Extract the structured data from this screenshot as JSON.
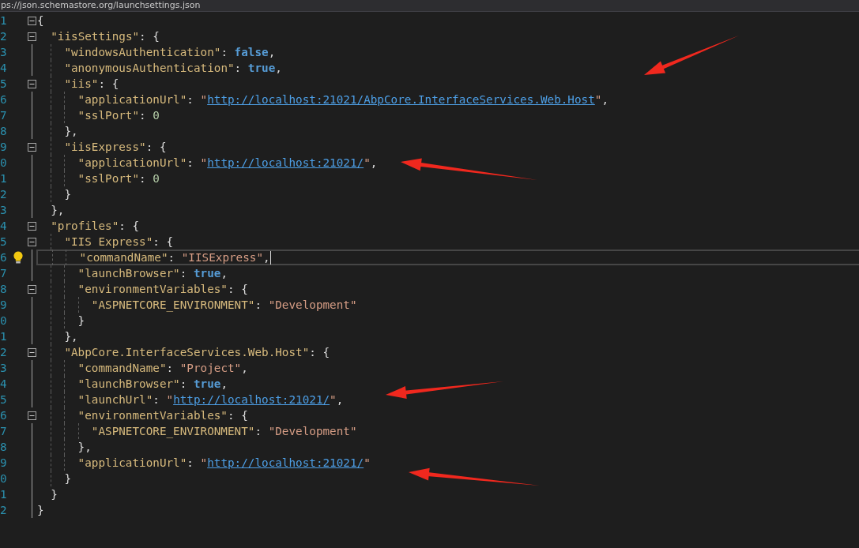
{
  "address_bar": {
    "text": "ps://json.schemastore.org/launchsettings.json"
  },
  "lines": [
    {
      "number": "1",
      "tokens": [
        {
          "kind": "punct",
          "text": "{"
        }
      ],
      "children": [
        {
          "number": "2",
          "tokens": [
            {
              "kind": "key",
              "text": "\"iisSettings\""
            },
            {
              "kind": "punct",
              "text": ": {"
            }
          ],
          "children": [
            {
              "number": "3",
              "tokens": [
                {
                  "kind": "key",
                  "text": "\"windowsAuthentication\""
                },
                {
                  "kind": "punct",
                  "text": ": "
                },
                {
                  "kind": "keyword",
                  "text": "false"
                },
                {
                  "kind": "punct",
                  "text": ","
                }
              ]
            },
            {
              "number": "4",
              "tokens": [
                {
                  "kind": "key",
                  "text": "\"anonymousAuthentication\""
                },
                {
                  "kind": "punct",
                  "text": ": "
                },
                {
                  "kind": "keyword",
                  "text": "true"
                },
                {
                  "kind": "punct",
                  "text": ","
                }
              ]
            },
            {
              "number": "5",
              "tokens": [
                {
                  "kind": "key",
                  "text": "\"iis\""
                },
                {
                  "kind": "punct",
                  "text": ": {"
                }
              ],
              "children": [
                {
                  "number": "6",
                  "tokens": [
                    {
                      "kind": "key",
                      "text": "\"applicationUrl\""
                    },
                    {
                      "kind": "punct",
                      "text": ": "
                    },
                    {
                      "kind": "string",
                      "text": "\""
                    },
                    {
                      "kind": "url",
                      "text": "http://localhost:21021/AbpCore.InterfaceServices.Web.Host"
                    },
                    {
                      "kind": "string",
                      "text": "\""
                    },
                    {
                      "kind": "punct",
                      "text": ","
                    }
                  ]
                },
                {
                  "number": "7",
                  "tokens": [
                    {
                      "kind": "key",
                      "text": "\"sslPort\""
                    },
                    {
                      "kind": "punct",
                      "text": ": "
                    },
                    {
                      "kind": "number",
                      "text": "0"
                    }
                  ]
                }
              ]
            },
            {
              "number": "8",
              "tokens": [
                {
                  "kind": "punct",
                  "text": "},"
                }
              ]
            },
            {
              "number": "9",
              "tokens": [
                {
                  "kind": "key",
                  "text": "\"iisExpress\""
                },
                {
                  "kind": "punct",
                  "text": ": {"
                }
              ],
              "children": [
                {
                  "number": "0",
                  "tokens": [
                    {
                      "kind": "key",
                      "text": "\"applicationUrl\""
                    },
                    {
                      "kind": "punct",
                      "text": ": "
                    },
                    {
                      "kind": "string",
                      "text": "\""
                    },
                    {
                      "kind": "url",
                      "text": "http://localhost:21021/"
                    },
                    {
                      "kind": "string",
                      "text": "\""
                    },
                    {
                      "kind": "punct",
                      "text": ","
                    }
                  ]
                },
                {
                  "number": "1",
                  "tokens": [
                    {
                      "kind": "key",
                      "text": "\"sslPort\""
                    },
                    {
                      "kind": "punct",
                      "text": ": "
                    },
                    {
                      "kind": "number",
                      "text": "0"
                    }
                  ]
                }
              ]
            },
            {
              "number": "2",
              "tokens": [
                {
                  "kind": "punct",
                  "text": "}"
                }
              ]
            }
          ]
        },
        {
          "number": "3",
          "tokens": [
            {
              "kind": "punct",
              "text": "},"
            }
          ]
        },
        {
          "number": "4",
          "tokens": [
            {
              "kind": "key",
              "text": "\"profiles\""
            },
            {
              "kind": "punct",
              "text": ": {"
            }
          ],
          "children": [
            {
              "number": "5",
              "tokens": [
                {
                  "kind": "key",
                  "text": "\"IIS Express\""
                },
                {
                  "kind": "punct",
                  "text": ": {"
                }
              ],
              "children": [
                {
                  "number": "6",
                  "current": true,
                  "lightbulb": true,
                  "tokens": [
                    {
                      "kind": "key",
                      "text": "\"commandName\""
                    },
                    {
                      "kind": "punct",
                      "text": ": "
                    },
                    {
                      "kind": "string",
                      "text": "\"IISExpress\""
                    },
                    {
                      "kind": "punct",
                      "text": ","
                    }
                  ]
                },
                {
                  "number": "7",
                  "tokens": [
                    {
                      "kind": "key",
                      "text": "\"launchBrowser\""
                    },
                    {
                      "kind": "punct",
                      "text": ": "
                    },
                    {
                      "kind": "keyword",
                      "text": "true"
                    },
                    {
                      "kind": "punct",
                      "text": ","
                    }
                  ]
                },
                {
                  "number": "8",
                  "tokens": [
                    {
                      "kind": "key",
                      "text": "\"environmentVariables\""
                    },
                    {
                      "kind": "punct",
                      "text": ": {"
                    }
                  ],
                  "children": [
                    {
                      "number": "9",
                      "tokens": [
                        {
                          "kind": "key",
                          "text": "\"ASPNETCORE_ENVIRONMENT\""
                        },
                        {
                          "kind": "punct",
                          "text": ": "
                        },
                        {
                          "kind": "string",
                          "text": "\"Development\""
                        }
                      ]
                    }
                  ]
                },
                {
                  "number": "0",
                  "tokens": [
                    {
                      "kind": "punct",
                      "text": "}"
                    }
                  ]
                }
              ]
            },
            {
              "number": "1",
              "tokens": [
                {
                  "kind": "punct",
                  "text": "},"
                }
              ]
            },
            {
              "number": "2",
              "tokens": [
                {
                  "kind": "key",
                  "text": "\"AbpCore.InterfaceServices.Web.Host\""
                },
                {
                  "kind": "punct",
                  "text": ": {"
                }
              ],
              "children": [
                {
                  "number": "3",
                  "tokens": [
                    {
                      "kind": "key",
                      "text": "\"commandName\""
                    },
                    {
                      "kind": "punct",
                      "text": ": "
                    },
                    {
                      "kind": "string",
                      "text": "\"Project\""
                    },
                    {
                      "kind": "punct",
                      "text": ","
                    }
                  ]
                },
                {
                  "number": "4",
                  "tokens": [
                    {
                      "kind": "key",
                      "text": "\"launchBrowser\""
                    },
                    {
                      "kind": "punct",
                      "text": ": "
                    },
                    {
                      "kind": "keyword",
                      "text": "true"
                    },
                    {
                      "kind": "punct",
                      "text": ","
                    }
                  ]
                },
                {
                  "number": "5",
                  "tokens": [
                    {
                      "kind": "key",
                      "text": "\"launchUrl\""
                    },
                    {
                      "kind": "punct",
                      "text": ": "
                    },
                    {
                      "kind": "string",
                      "text": "\""
                    },
                    {
                      "kind": "url",
                      "text": "http://localhost:21021/"
                    },
                    {
                      "kind": "string",
                      "text": "\""
                    },
                    {
                      "kind": "punct",
                      "text": ","
                    }
                  ]
                },
                {
                  "number": "6",
                  "tokens": [
                    {
                      "kind": "key",
                      "text": "\"environmentVariables\""
                    },
                    {
                      "kind": "punct",
                      "text": ": {"
                    }
                  ],
                  "children": [
                    {
                      "number": "7",
                      "tokens": [
                        {
                          "kind": "key",
                          "text": "\"ASPNETCORE_ENVIRONMENT\""
                        },
                        {
                          "kind": "punct",
                          "text": ": "
                        },
                        {
                          "kind": "string",
                          "text": "\"Development\""
                        }
                      ]
                    }
                  ]
                },
                {
                  "number": "8",
                  "tokens": [
                    {
                      "kind": "punct",
                      "text": "},"
                    }
                  ]
                },
                {
                  "number": "9",
                  "tokens": [
                    {
                      "kind": "key",
                      "text": "\"applicationUrl\""
                    },
                    {
                      "kind": "punct",
                      "text": ": "
                    },
                    {
                      "kind": "string",
                      "text": "\""
                    },
                    {
                      "kind": "url",
                      "text": "http://localhost:21021/"
                    },
                    {
                      "kind": "string",
                      "text": "\""
                    }
                  ]
                }
              ]
            },
            {
              "number": "0",
              "tokens": [
                {
                  "kind": "punct",
                  "text": "}"
                }
              ]
            }
          ]
        },
        {
          "number": "1",
          "tokens": [
            {
              "kind": "punct",
              "text": "}"
            }
          ]
        }
      ]
    },
    {
      "number": "2",
      "tokens": [
        {
          "kind": "punct",
          "text": "}"
        }
      ]
    }
  ],
  "annotations": [
    {
      "kind": "arrow"
    },
    {
      "kind": "arrow"
    },
    {
      "kind": "arrow"
    },
    {
      "kind": "arrow"
    }
  ]
}
